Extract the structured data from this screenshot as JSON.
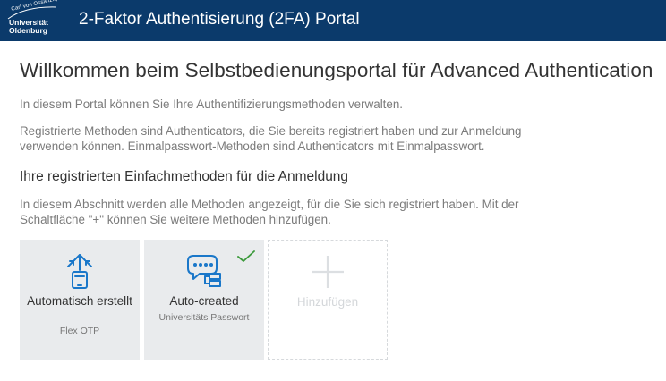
{
  "header": {
    "logo_small": "Carl von Ossietzky",
    "logo_line1": "Universität",
    "logo_line2": "Oldenburg",
    "title": "2-Faktor Authentisierung (2FA) Portal"
  },
  "main": {
    "title": "Willkommen beim Selbstbedienungsportal für Advanced Authentication",
    "intro": "In diesem Portal können Sie Ihre Authentifizierungsmethoden verwalten.",
    "description": "Registrierte Methoden sind Authenticators, die Sie bereits registriert haben und zur Anmeldung verwenden können. Einmalpasswort-Methoden sind Authenticators mit Einmalpasswort.",
    "section_heading": "Ihre registrierten Einfachmethoden für die Anmeldung",
    "section_text": "In diesem Abschnitt werden alle Methoden angezeigt, für die Sie sich registriert haben. Mit der Schaltfläche \"+\" können Sie weitere Methoden hinzufügen."
  },
  "methods": [
    {
      "name": "Automatisch erstellt",
      "type": "Flex OTP",
      "icon": "flex-otp-icon"
    },
    {
      "name": "Auto-created",
      "type": "Universitäts Passwort",
      "icon": "password-chat-icon",
      "default": true
    }
  ],
  "add_tile": {
    "label": "Hinzufügen",
    "icon": "plus-icon"
  },
  "colors": {
    "header_bg": "#0b3a6b",
    "accent_blue": "#1a77c9",
    "check_green": "#3c9a3c",
    "tile_bg": "#e9ebed"
  }
}
